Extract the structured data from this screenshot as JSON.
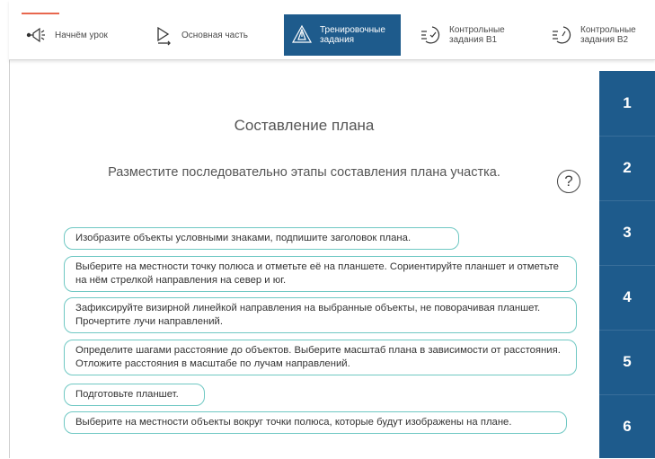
{
  "nav": {
    "accent_color": "#e8674e",
    "active_color": "#1e5b8c",
    "tabs": [
      {
        "label": "Начнём урок",
        "icon": "megaphone-icon"
      },
      {
        "label": "Основная часть",
        "icon": "play-icon"
      },
      {
        "label": "Тренировочные задания",
        "icon": "triangle-warning-icon",
        "active": true
      },
      {
        "label": "Контрольные задания В1",
        "icon": "clock-check-icon"
      },
      {
        "label": "Контрольные задания В2",
        "icon": "clock-check-icon"
      }
    ]
  },
  "main": {
    "title": "Составление плана",
    "instruction": "Разместите последовательно этапы составления плана участка.",
    "help_label": "?"
  },
  "cards": [
    "Изобразите объекты условными знаками, подпишите заголовок плана.",
    "Выберите на местности точку полюса и отметьте её на планшете. Сориентируйте планшет и отметьте на нём стрелкой направления на север и юг.",
    "Зафиксируйте визирной линейкой направления на выбранные объекты, не поворачивая планшет. Прочертите лучи направлений.",
    "Определите шагами расстояние до объектов. Выберите масштаб плана в зависимости от расстояния. Отложите расстояния в масштабе по лучам направлений.",
    "Подготовьте планшет.",
    "Выберите на местности объекты вокруг точки полюса, которые будут изображены на плане."
  ],
  "slots": [
    "1",
    "2",
    "3",
    "4",
    "5",
    "6"
  ]
}
